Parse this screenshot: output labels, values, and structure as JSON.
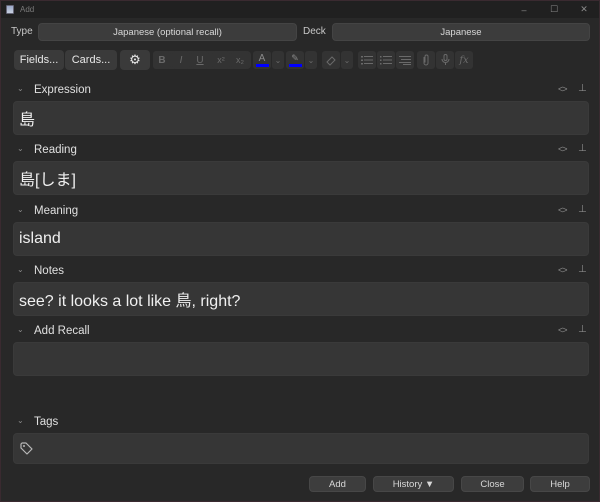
{
  "window": {
    "title": "Add",
    "controls": {
      "minimize": "–",
      "maximize": "☐",
      "close": "✕"
    }
  },
  "selectors": {
    "type_label": "Type",
    "type_value": "Japanese (optional recall)",
    "deck_label": "Deck",
    "deck_value": "Japanese"
  },
  "toolbar": {
    "fields_label": "Fields...",
    "cards_label": "Cards...",
    "gear_icon": "⚙",
    "bold": "B",
    "italic": "I",
    "underline": "U",
    "superscript": "x²",
    "subscript": "x₂",
    "text_color_glyph": "A",
    "text_color": "#0000ff",
    "highlight_color": "#0000ff",
    "dropdown_glyph": "⌄",
    "fx_glyph": "fx"
  },
  "fields": [
    {
      "name": "Expression",
      "value": "島"
    },
    {
      "name": "Reading",
      "value": "島[しま]"
    },
    {
      "name": "Meaning",
      "value": "island"
    },
    {
      "name": "Notes",
      "value": "see? it looks a lot like 鳥, right?"
    },
    {
      "name": "Add Recall",
      "value": ""
    }
  ],
  "field_icons": {
    "html_toggle": "<>",
    "pin": "📌",
    "collapse": "⌄"
  },
  "tags": {
    "label": "Tags",
    "value": ""
  },
  "buttons": {
    "add": "Add",
    "history": "History ▼",
    "close": "Close",
    "help": "Help"
  }
}
